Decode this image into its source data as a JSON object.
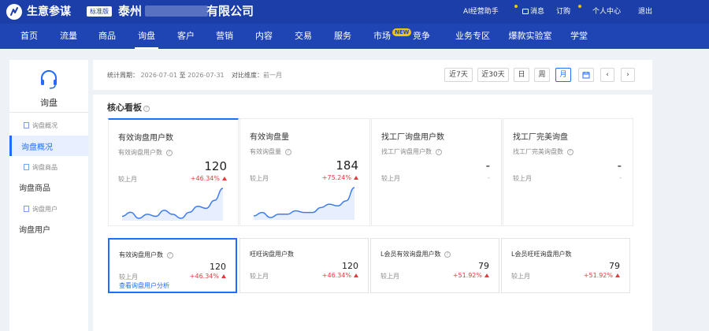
{
  "header": {
    "brand": "生意参谋",
    "edition": "标准版",
    "company_prefix": "泰州",
    "company_suffix": "有限公司",
    "ai_assistant": "AI经营助手",
    "messages": "消息",
    "subscribe": "订购",
    "personal_center": "个人中心",
    "logout": "退出"
  },
  "nav": {
    "items": [
      "首页",
      "流量",
      "商品",
      "询盘",
      "客户",
      "营销",
      "内容",
      "交易",
      "服务",
      "市场",
      "竞争",
      "业务专区",
      "爆款实验室",
      "学堂"
    ],
    "active": "询盘",
    "new_badge": "NEW"
  },
  "sidebar": {
    "title": "询盘",
    "items": [
      {
        "label": "询盘概况",
        "kind": "sub"
      },
      {
        "label": "询盘概况",
        "kind": "main",
        "active": true
      },
      {
        "label": "询盘商品",
        "kind": "sub"
      },
      {
        "label": "询盘商品",
        "kind": "main"
      },
      {
        "label": "询盘用户",
        "kind": "sub"
      },
      {
        "label": "询盘用户",
        "kind": "main"
      }
    ]
  },
  "filter": {
    "period_label": "统计周期：",
    "period_start": "2026-07-01",
    "period_to": "至",
    "period_end": "2026-07-31",
    "compare_label": "对比维度：",
    "compare_value": "前一月",
    "buttons": [
      "近7天",
      "近30天",
      "日",
      "周",
      "月"
    ],
    "active_button": "月",
    "prev_symbol": "‹",
    "next_symbol": "›"
  },
  "board": {
    "title": "核心看板",
    "help_symbol": "?",
    "cards": [
      {
        "title": "有效询盘用户数",
        "sub": "有效询盘用户数",
        "value": "120",
        "compare": "较上月",
        "pct": "+46.34%",
        "spark": [
          8,
          10,
          7,
          9,
          8,
          11,
          9,
          7,
          10,
          13,
          12,
          16,
          22
        ]
      },
      {
        "title": "有效询盘量",
        "sub": "有效询盘量",
        "value": "184",
        "compare": "较上月",
        "pct": "+75.24%",
        "spark": [
          7,
          9,
          6,
          8,
          8,
          10,
          9,
          9,
          12,
          14,
          13,
          16,
          24
        ]
      },
      {
        "title": "找工厂询盘用户数",
        "sub": "找工厂询盘用户数",
        "value": "-",
        "compare": "较上月",
        "pct": "-"
      },
      {
        "title": "找工厂完美询盘",
        "sub": "找工厂完美询盘数",
        "value": "-",
        "compare": "较上月",
        "pct": "-"
      }
    ],
    "mini_cards": [
      {
        "title": "有效询盘用户数",
        "value": "120",
        "compare": "较上月",
        "pct": "+46.34%",
        "link": "查看询盘用户分析"
      },
      {
        "title": "旺旺询盘用户数",
        "value": "120",
        "compare": "较上月",
        "pct": "+46.34%"
      },
      {
        "title": "L会员有效询盘用户数",
        "value": "79",
        "compare": "较上月",
        "pct": "+51.92%"
      },
      {
        "title": "L会员旺旺询盘用户数",
        "value": "79",
        "compare": "较上月",
        "pct": "+51.92%"
      }
    ]
  },
  "colors": {
    "topbar": "#1b3ea8",
    "nav": "#1f45b4",
    "accent": "#1f6cff",
    "up": "#e23c3c",
    "spark": "#3d7bf5"
  }
}
